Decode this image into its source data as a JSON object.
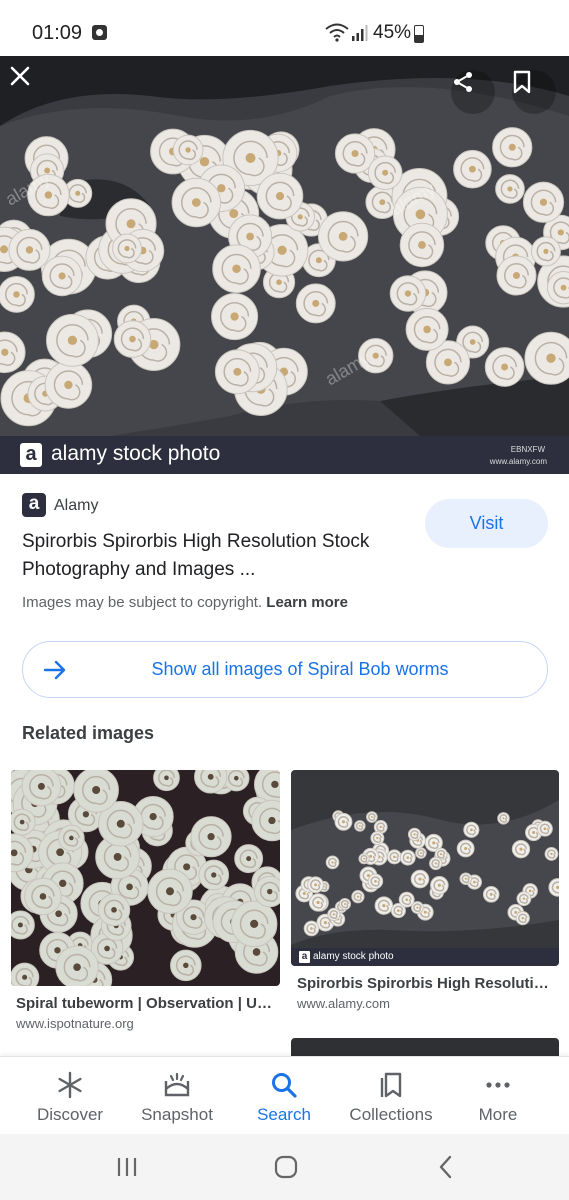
{
  "status_bar": {
    "time": "01:09",
    "battery": "45%"
  },
  "hero": {
    "brand_text": "alamy stock photo",
    "image_code": "EBNXFW",
    "image_url_text": "www.alamy.com",
    "watermark": "alamy"
  },
  "result": {
    "source_logo": "a",
    "source_name": "Alamy",
    "visit_label": "Visit",
    "title": "Spirorbis Spirorbis High Resolution Stock Photography and Images ...",
    "copyright_text": "Images may be subject to copyright.",
    "learn_more": "Learn more",
    "show_all_label": "Show all images of Spiral Bob worms"
  },
  "related": {
    "heading": "Related images",
    "items": [
      {
        "title": "Spiral tubeworm | Observation | UK...",
        "source": "www.ispotnature.org"
      },
      {
        "title": "Spirorbis Spirorbis High Resolutio...",
        "source": "www.alamy.com",
        "brand_text": "alamy stock photo"
      }
    ]
  },
  "bottom_nav": {
    "items": [
      {
        "label": "Discover",
        "icon": "asterisk-icon"
      },
      {
        "label": "Snapshot",
        "icon": "snapshot-icon"
      },
      {
        "label": "Search",
        "icon": "search-icon",
        "active": true
      },
      {
        "label": "Collections",
        "icon": "collections-icon"
      },
      {
        "label": "More",
        "icon": "more-dots-icon"
      }
    ]
  },
  "colors": {
    "accent": "#1a73e8",
    "brand_bar": "#2d2f3e",
    "visit_bg": "#e8f0fe"
  }
}
